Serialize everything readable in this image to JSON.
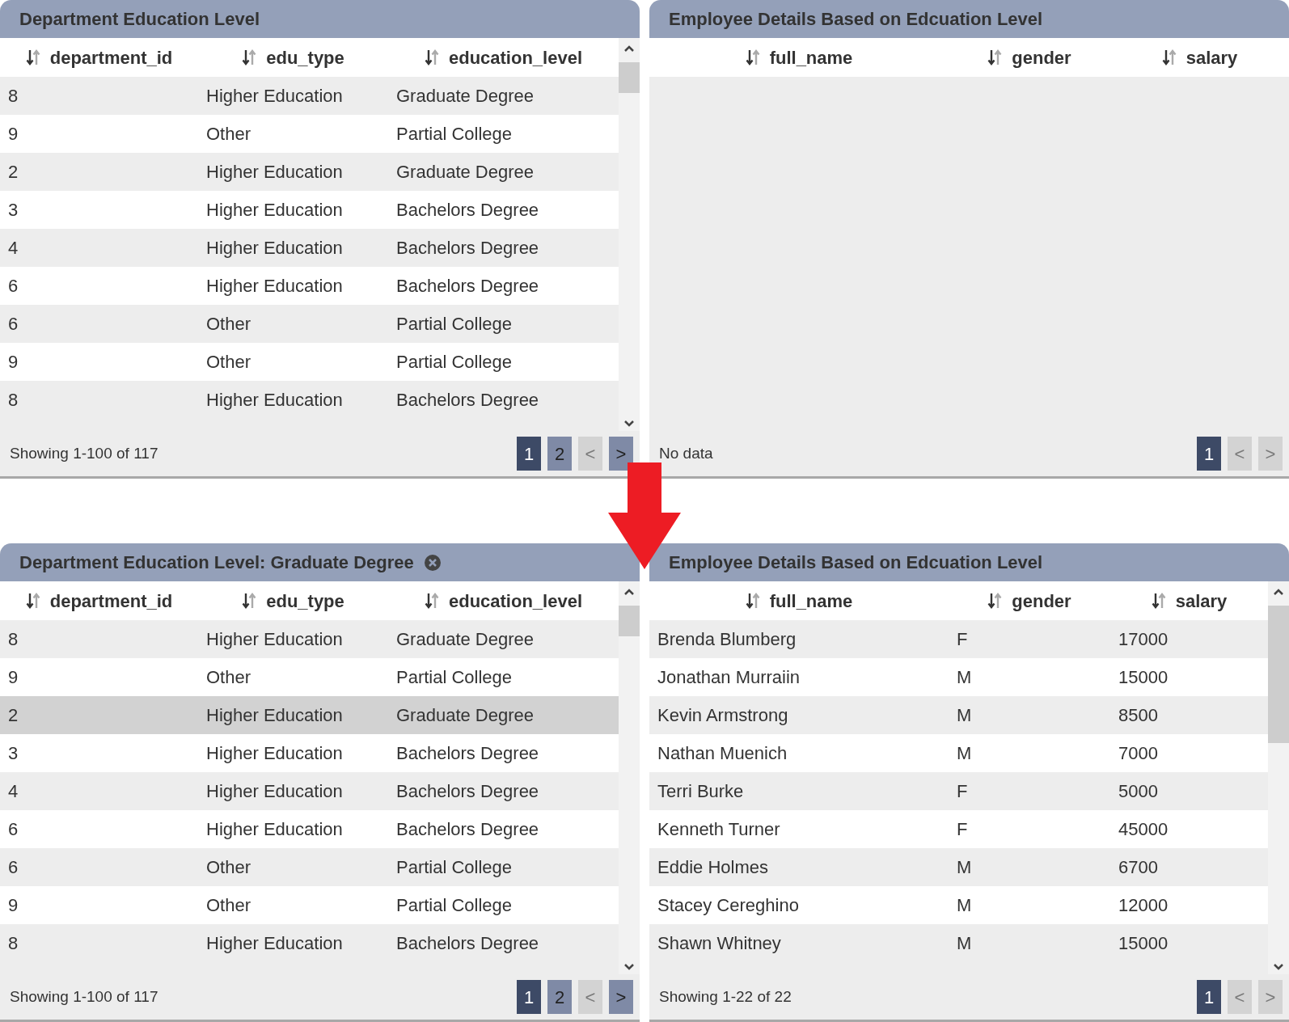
{
  "panels": [
    {
      "title": "Department Education Level",
      "columns": [
        "department_id",
        "edu_type",
        "education_level"
      ],
      "scrollbar": true,
      "rows": [
        {
          "cells": [
            "8",
            "Higher Education",
            "Graduate Degree"
          ],
          "selected": false
        },
        {
          "cells": [
            "9",
            "Other",
            "Partial College"
          ],
          "selected": false
        },
        {
          "cells": [
            "2",
            "Higher Education",
            "Graduate Degree"
          ],
          "selected": false
        },
        {
          "cells": [
            "3",
            "Higher Education",
            "Bachelors Degree"
          ],
          "selected": false
        },
        {
          "cells": [
            "4",
            "Higher Education",
            "Bachelors Degree"
          ],
          "selected": false
        },
        {
          "cells": [
            "6",
            "Higher Education",
            "Bachelors Degree"
          ],
          "selected": false
        },
        {
          "cells": [
            "6",
            "Other",
            "Partial College"
          ],
          "selected": false
        },
        {
          "cells": [
            "9",
            "Other",
            "Partial College"
          ],
          "selected": false
        },
        {
          "cells": [
            "8",
            "Higher Education",
            "Bachelors Degree"
          ],
          "selected": false
        }
      ],
      "footer": "Showing 1-100 of 117",
      "pager": [
        {
          "kind": "page",
          "label": "1",
          "selected": true
        },
        {
          "kind": "page",
          "label": "2",
          "selected": false
        },
        {
          "kind": "prev",
          "label": "<",
          "disabled": true
        },
        {
          "kind": "next",
          "label": ">",
          "disabled": false
        }
      ]
    },
    {
      "title": "Employee Details Based on Edcuation Level",
      "columns": [
        "full_name",
        "gender",
        "salary"
      ],
      "footer": "No data",
      "pager": [
        {
          "kind": "page",
          "label": "1",
          "selected": true
        },
        {
          "kind": "prev",
          "label": "<",
          "disabled": true
        },
        {
          "kind": "next",
          "label": ">",
          "disabled": true
        }
      ]
    },
    {
      "title": "Department Education Level: Graduate Degree",
      "filter_clear": true,
      "columns": [
        "department_id",
        "edu_type",
        "education_level"
      ],
      "scrollbar": true,
      "rows": [
        {
          "cells": [
            "8",
            "Higher Education",
            "Graduate Degree"
          ],
          "selected": false
        },
        {
          "cells": [
            "9",
            "Other",
            "Partial College"
          ],
          "selected": false
        },
        {
          "cells": [
            "2",
            "Higher Education",
            "Graduate Degree"
          ],
          "selected": true
        },
        {
          "cells": [
            "3",
            "Higher Education",
            "Bachelors Degree"
          ],
          "selected": false
        },
        {
          "cells": [
            "4",
            "Higher Education",
            "Bachelors Degree"
          ],
          "selected": false
        },
        {
          "cells": [
            "6",
            "Higher Education",
            "Bachelors Degree"
          ],
          "selected": false
        },
        {
          "cells": [
            "6",
            "Other",
            "Partial College"
          ],
          "selected": false
        },
        {
          "cells": [
            "9",
            "Other",
            "Partial College"
          ],
          "selected": false
        },
        {
          "cells": [
            "8",
            "Higher Education",
            "Bachelors Degree"
          ],
          "selected": false
        }
      ],
      "footer": "Showing 1-100 of 117",
      "pager": [
        {
          "kind": "page",
          "label": "1",
          "selected": true
        },
        {
          "kind": "page",
          "label": "2",
          "selected": false
        },
        {
          "kind": "prev",
          "label": "<",
          "disabled": true
        },
        {
          "kind": "next",
          "label": ">",
          "disabled": false
        }
      ]
    },
    {
      "title": "Employee Details Based on Edcuation Level",
      "columns": [
        "full_name",
        "gender",
        "salary"
      ],
      "scrollbar": true,
      "rows": [
        {
          "cells": [
            "Brenda Blumberg",
            "F",
            "17000"
          ],
          "selected": false
        },
        {
          "cells": [
            "Jonathan Murraiin",
            "M",
            "15000"
          ],
          "selected": false
        },
        {
          "cells": [
            "Kevin Armstrong",
            "M",
            "8500"
          ],
          "selected": false
        },
        {
          "cells": [
            "Nathan Muenich",
            "M",
            "7000"
          ],
          "selected": false
        },
        {
          "cells": [
            "Terri Burke",
            "F",
            "5000"
          ],
          "selected": false
        },
        {
          "cells": [
            "Kenneth Turner",
            "F",
            "45000"
          ],
          "selected": false
        },
        {
          "cells": [
            "Eddie Holmes",
            "M",
            "6700"
          ],
          "selected": false
        },
        {
          "cells": [
            "Stacey Cereghino",
            "M",
            "12000"
          ],
          "selected": false
        },
        {
          "cells": [
            "Shawn Whitney",
            "M",
            "15000"
          ],
          "selected": false
        }
      ],
      "footer": "Showing 1-22 of 22",
      "pager": [
        {
          "kind": "page",
          "label": "1",
          "selected": true
        },
        {
          "kind": "prev",
          "label": "<",
          "disabled": true
        },
        {
          "kind": "next",
          "label": ">",
          "disabled": true
        }
      ]
    }
  ]
}
